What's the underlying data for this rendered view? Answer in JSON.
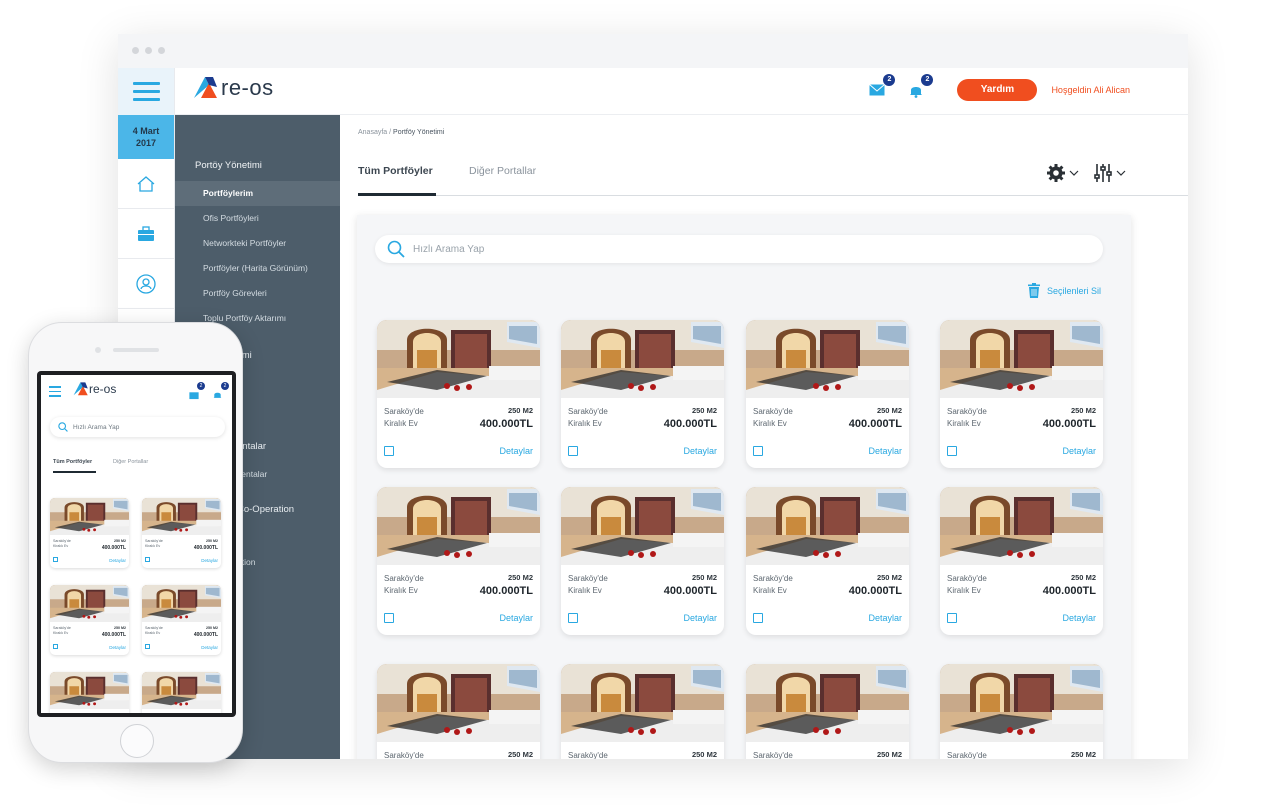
{
  "date": {
    "day": "4 Mart",
    "year": "2017"
  },
  "brand": {
    "name": "re-os"
  },
  "topbar": {
    "mail_count": "2",
    "bell_count": "2",
    "help_label": "Yardım",
    "welcome": "Hoşgeldin Ali Alican"
  },
  "nav": {
    "group": "Portöy Yönetimi",
    "items": [
      "Portföylerim",
      "Ofis Portföyleri",
      "Networkteki Portföyler",
      "Portföyler (Harita Görünüm)",
      "Portföy Görevleri",
      "Toplu Portföy Aktarımı"
    ],
    "partial": [
      "timi",
      "entalar",
      "centalar",
      "Co-Operation",
      "ation"
    ]
  },
  "breadcrumb": {
    "home": "Anasayfa",
    "sep": "/",
    "current": "Portföy Yönetimi"
  },
  "tabs": [
    "Tüm Portföyler",
    "Diğer Portallar"
  ],
  "search": {
    "placeholder": "Hızlı Arama Yap"
  },
  "delete_selected": "Seçilenleri Sil",
  "listing": {
    "location": "Saraköy'de",
    "type": "Kiralık Ev",
    "size": "250 M2",
    "price": "400.000TL",
    "details": "Detaylar"
  },
  "colors": {
    "accent": "#29a8e1",
    "orange": "#f04e1f",
    "nav": "#4d5d6a",
    "badge": "#1b3b8f"
  }
}
